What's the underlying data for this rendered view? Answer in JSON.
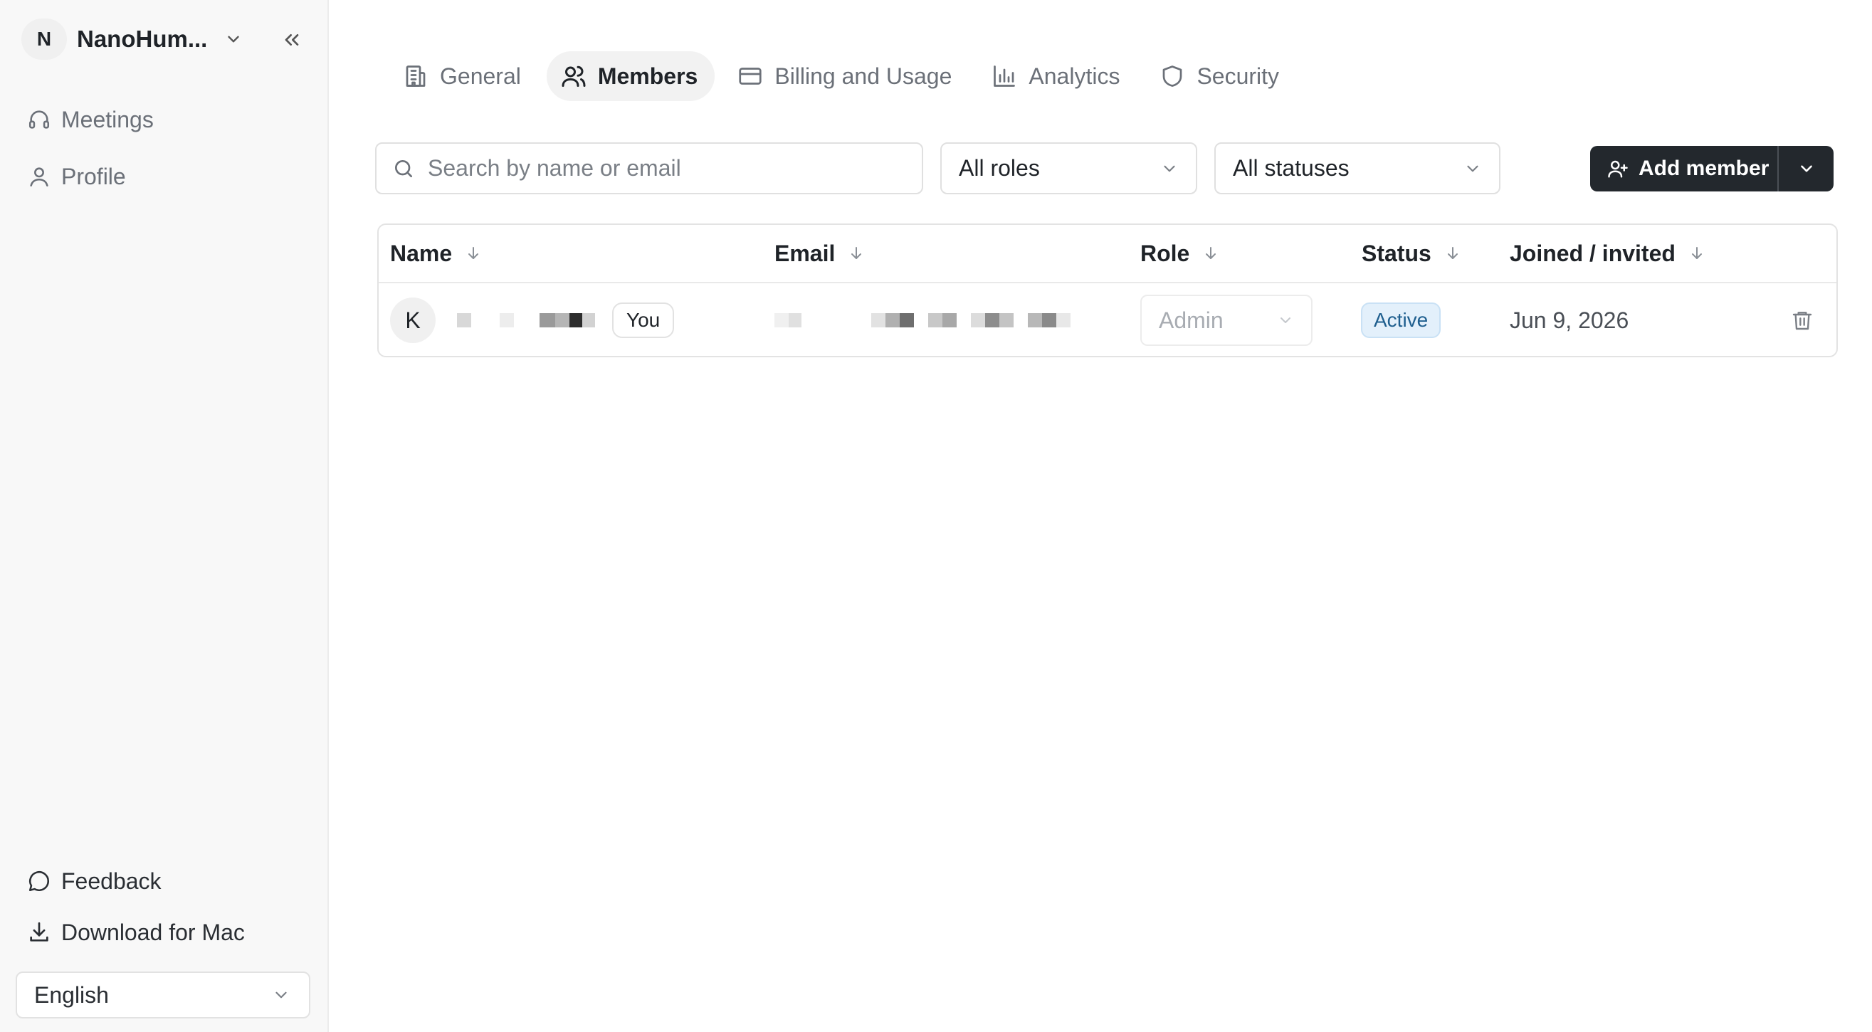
{
  "sidebar": {
    "workspace": {
      "initial": "N",
      "name": "NanoHum..."
    },
    "nav": [
      {
        "label": "Meetings",
        "icon": "headset-icon"
      },
      {
        "label": "Profile",
        "icon": "user-icon"
      }
    ],
    "footer": [
      {
        "label": "Feedback",
        "icon": "message-circle-icon"
      },
      {
        "label": "Download for Mac",
        "icon": "download-icon"
      }
    ],
    "language": "English"
  },
  "tabs": [
    {
      "label": "General",
      "icon": "building-icon",
      "active": false
    },
    {
      "label": "Members",
      "icon": "users-icon",
      "active": true
    },
    {
      "label": "Billing and Usage",
      "icon": "credit-card-icon",
      "active": false
    },
    {
      "label": "Analytics",
      "icon": "bar-chart-icon",
      "active": false
    },
    {
      "label": "Security",
      "icon": "shield-icon",
      "active": false
    }
  ],
  "toolbar": {
    "search_placeholder": "Search by name or email",
    "role_filter": "All roles",
    "status_filter": "All statuses",
    "add_member_label": "Add member"
  },
  "table": {
    "columns": [
      "Name",
      "Email",
      "Role",
      "Status",
      "Joined / invited"
    ],
    "rows": [
      {
        "avatar_initial": "K",
        "name_redacted": true,
        "you_badge": "You",
        "email_redacted": true,
        "role": "Admin",
        "status": "Active",
        "joined": "Jun 9, 2026"
      }
    ]
  },
  "colors": {
    "primary_button": "#23282d",
    "status_active_bg": "#e3f0fb",
    "status_active_text": "#1f5f8f",
    "sidebar_bg": "#f8f8f8"
  }
}
